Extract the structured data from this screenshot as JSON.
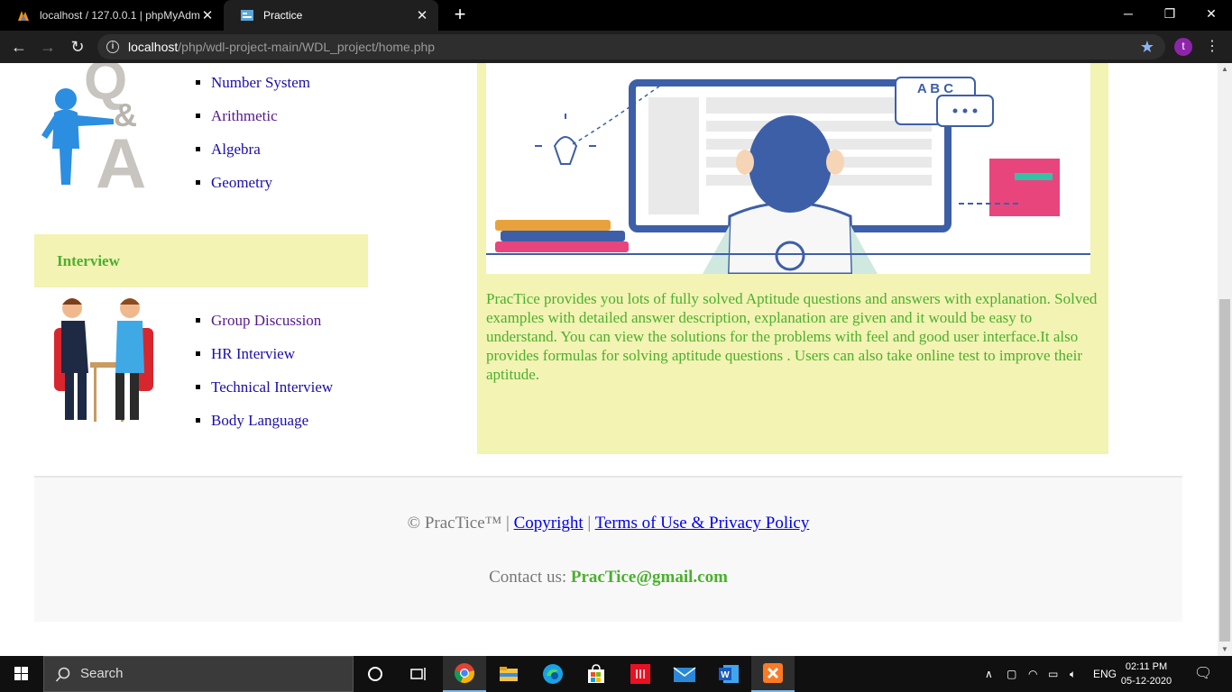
{
  "browser": {
    "tabs": [
      {
        "title": "localhost / 127.0.0.1 | phpMyAdm",
        "active": false
      },
      {
        "title": "Practice",
        "active": true
      }
    ],
    "url_host": "localhost",
    "url_path": "/php/wdl-project-main/WDL_project/home.php",
    "profile_initial": "t"
  },
  "page": {
    "aptitude_topics": [
      "Number System",
      "Arithmetic",
      "Algebra",
      "Geometry"
    ],
    "interview_heading": "Interview",
    "interview_topics": [
      "Group Discussion",
      "HR Interview",
      "Technical Interview",
      "Body Language"
    ],
    "illustration_text": "A B C",
    "description": "PracTice provides you lots of fully solved Aptitude questions and answers with explanation. Solved examples with detailed answer description, explanation are given and it would be easy to understand. You can view the solutions for the problems with feel and good user interface.It also provides formulas for solving aptitude questions . Users can also take online test to improve their aptitude.",
    "footer": {
      "copyright_prefix": "© PracTice™ |",
      "copyright_link": "Copyright",
      "separator": "|",
      "terms_link": "Terms of Use & Privacy Policy",
      "contact_label": "Contact us:",
      "contact_email": "PracTice@gmail.com"
    }
  },
  "taskbar": {
    "search_placeholder": "Search",
    "language": "ENG",
    "time": "02:11 PM",
    "date": "05-12-2020"
  },
  "colors": {
    "accent_green": "#4caf2f",
    "panel_yellow": "#f3f3b3",
    "link_blue": "#1a0dab"
  }
}
